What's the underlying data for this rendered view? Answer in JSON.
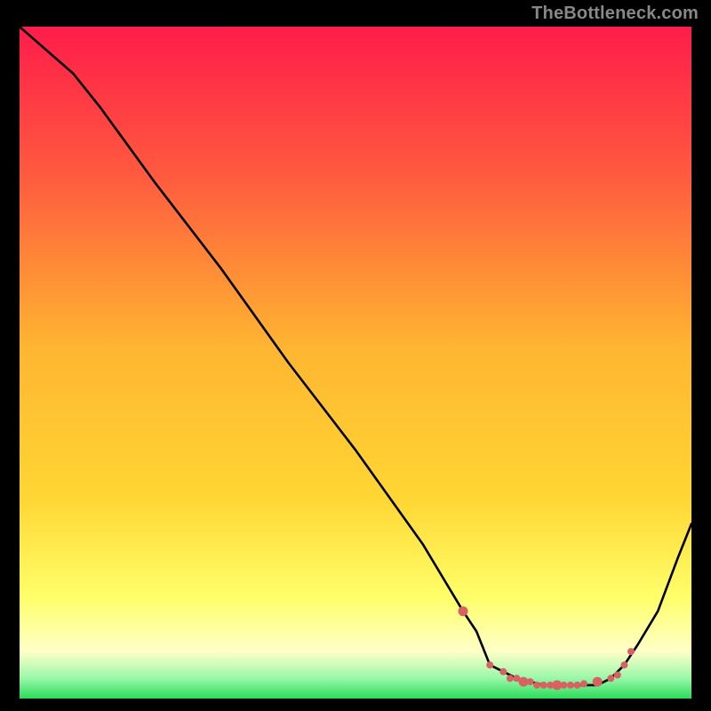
{
  "watermark": "TheBottleneck.com",
  "colors": {
    "bg": "#000000",
    "gradient_top": "#ff1c4a",
    "gradient_mid_upper": "#ff7a3f",
    "gradient_mid": "#ffd633",
    "gradient_lower": "#ffff55",
    "gradient_pale": "#ffffcc",
    "gradient_green": "#2bdc5a",
    "line": "#000000",
    "marker": "#d86262"
  },
  "chart_data": {
    "type": "line",
    "title": "",
    "xlabel": "",
    "ylabel": "",
    "xlim": [
      0,
      100
    ],
    "ylim": [
      0,
      100
    ],
    "grid": false,
    "legend": false,
    "series": [
      {
        "name": "curve",
        "x": [
          0,
          8,
          12,
          20,
          30,
          40,
          50,
          60,
          66,
          68,
          70,
          74,
          78,
          82,
          86,
          88,
          90,
          92,
          95,
          98,
          100
        ],
        "y": [
          100,
          93,
          88,
          77,
          64,
          50,
          37,
          23,
          13,
          10,
          5,
          3,
          2,
          2,
          2,
          3,
          5,
          8,
          13,
          21,
          26
        ]
      }
    ],
    "markers": {
      "name": "sweet-spot",
      "x": [
        66,
        70,
        72,
        73,
        74,
        75,
        76,
        77,
        78,
        79,
        80,
        81,
        82,
        83,
        84,
        86,
        88,
        89,
        90,
        91
      ],
      "y": [
        13,
        5,
        4,
        3,
        3,
        2.5,
        2.5,
        2,
        2,
        2,
        2,
        2,
        2,
        2,
        2.2,
        2.5,
        3,
        3.5,
        5,
        7
      ]
    }
  }
}
